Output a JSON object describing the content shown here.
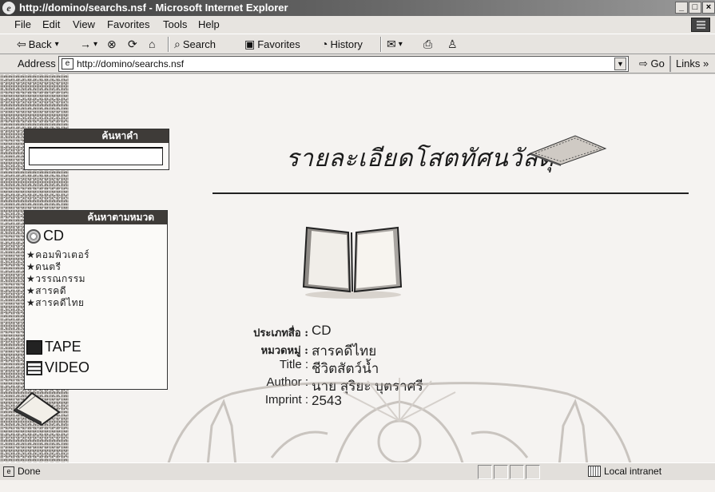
{
  "window": {
    "title": "http://domino/searchs.nsf - Microsoft Internet Explorer",
    "buttons": [
      "_",
      "□",
      "×"
    ]
  },
  "menu": [
    "File",
    "Edit",
    "View",
    "Favorites",
    "Tools",
    "Help"
  ],
  "toolbar": {
    "back": "Back",
    "search": "Search",
    "favorites": "Favorites",
    "history": "History"
  },
  "address": {
    "label": "Address",
    "url": "http://domino/searchs.nsf",
    "go": "Go",
    "links": "Links »"
  },
  "sidebar": {
    "search_heading": "ค้นหาคำ",
    "search_value": "",
    "category_heading": "ค้นหาตามหมวด",
    "categories": [
      {
        "label": "CD",
        "icon": "cd-icon"
      },
      {
        "label": "TAPE",
        "icon": "tape-icon"
      },
      {
        "label": "VIDEO",
        "icon": "video-icon"
      }
    ],
    "cd_subitems": [
      "★คอมพิวเตอร์",
      "★ดนตรี",
      "★วรรณกรรม",
      "★สารคดี",
      "★สารคดีไทย"
    ]
  },
  "page": {
    "header": "รายละเอียดโสตทัศนวัสดุ",
    "details": [
      {
        "label": "ประเภทสื่อ :",
        "value": "CD"
      },
      {
        "label": "หมวดหมู่ :",
        "value": "สารคดีไทย"
      },
      {
        "label": "Title :",
        "value": "ชีวิตสัตว์น้ำ"
      },
      {
        "label": "Author :",
        "value": "นาย สุริยะ บุตราศรี"
      },
      {
        "label": "Imprint :",
        "value": "2543"
      }
    ]
  },
  "status": {
    "text": "Done",
    "zone": "Local intranet"
  }
}
